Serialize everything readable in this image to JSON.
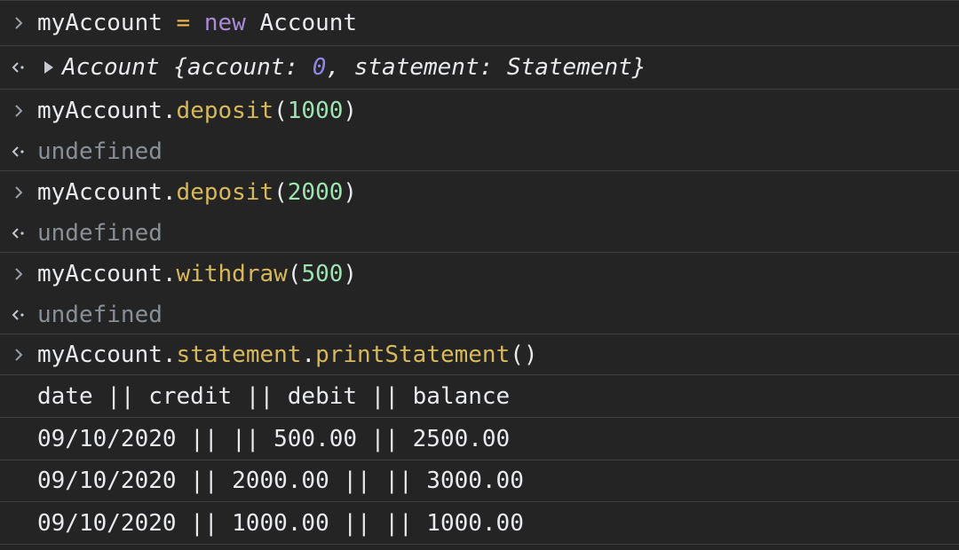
{
  "console": {
    "entries": [
      {
        "kind": "input",
        "parts": [
          "myAccount",
          " = ",
          "new",
          " Account"
        ]
      },
      {
        "kind": "output-object",
        "parts": [
          "Account {account: ",
          "0",
          ", statement: Statement}"
        ]
      },
      {
        "kind": "input",
        "parts": [
          "myAccount.",
          "deposit",
          "(",
          "1000",
          ")"
        ]
      },
      {
        "kind": "output",
        "text": "undefined"
      },
      {
        "kind": "input",
        "parts": [
          "myAccount.",
          "deposit",
          "(",
          "2000",
          ")"
        ]
      },
      {
        "kind": "output",
        "text": "undefined"
      },
      {
        "kind": "input",
        "parts": [
          "myAccount.",
          "withdraw",
          "(",
          "500",
          ")"
        ]
      },
      {
        "kind": "output",
        "text": "undefined"
      },
      {
        "kind": "input",
        "parts": [
          "myAccount.",
          "statement",
          ".",
          "printStatement",
          "()"
        ]
      },
      {
        "kind": "log",
        "text": "date || credit || debit || balance"
      },
      {
        "kind": "log",
        "text": "09/10/2020 || || 500.00 || 2500.00"
      },
      {
        "kind": "log",
        "text": "09/10/2020 || 2000.00 || || 3000.00"
      },
      {
        "kind": "log",
        "text": "09/10/2020 || 1000.00 || || 1000.00"
      }
    ]
  },
  "icons": {
    "input_prompt": "chevron-right-icon",
    "output_result": "return-arrow-icon",
    "expand": "expand-triangle-icon"
  },
  "colors": {
    "background": "#242424",
    "text": "#e8eaed",
    "operator": "#f2b94e",
    "keyword": "#a98bd8",
    "method": "#d7b85a",
    "number": "#9fe3b3",
    "undefined": "#8a8f96",
    "object_number": "#8f86e6"
  }
}
